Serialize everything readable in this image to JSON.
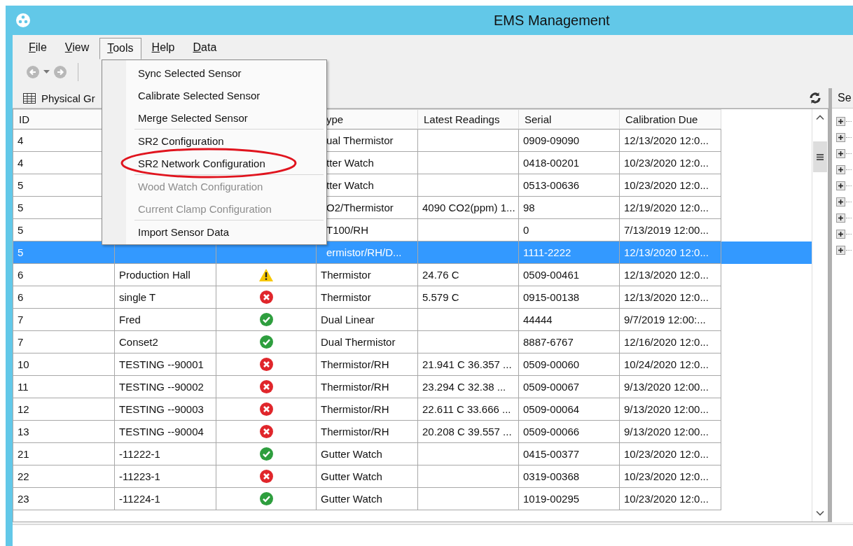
{
  "window": {
    "title": "EMS Management"
  },
  "menu_bar": [
    {
      "label": "File",
      "selected": false
    },
    {
      "label": "View",
      "selected": false
    },
    {
      "label": "Tools",
      "selected": true
    },
    {
      "label": "Help",
      "selected": false
    },
    {
      "label": "Data",
      "selected": false
    }
  ],
  "tools_menu": [
    {
      "kind": "item",
      "label": "Sync Selected Sensor",
      "disabled": false
    },
    {
      "kind": "item",
      "label": "Calibrate Selected Sensor",
      "disabled": false
    },
    {
      "kind": "item",
      "label": "Merge Selected Sensor",
      "disabled": false
    },
    {
      "kind": "separator"
    },
    {
      "kind": "item",
      "label": "SR2 Configuration",
      "disabled": false
    },
    {
      "kind": "item",
      "label": "SR2 Network Configuration",
      "disabled": false,
      "circled": true
    },
    {
      "kind": "separator"
    },
    {
      "kind": "item",
      "label": "Wood Watch Configuration",
      "disabled": true
    },
    {
      "kind": "item",
      "label": "Current Clamp Configuration",
      "disabled": true
    },
    {
      "kind": "separator"
    },
    {
      "kind": "item",
      "label": "Import Sensor Data",
      "disabled": false
    }
  ],
  "left_panel": {
    "title": "Physical Gr"
  },
  "table": {
    "columns": {
      "id": "ID",
      "type": "ype",
      "readings": "Latest Readings",
      "serial": "Serial",
      "due": "Calibration Due"
    },
    "rows": [
      {
        "id": "4",
        "type": "ual Thermistor",
        "serial": "0909-09090",
        "due": "12/13/2020 12:0...",
        "selected": false
      },
      {
        "id": "4",
        "type": "tter Watch",
        "serial": "0418-00201",
        "due": "10/23/2020 12:0...",
        "selected": false
      },
      {
        "id": "5",
        "type": "tter Watch",
        "serial": "0513-00636",
        "due": "10/23/2020 12:0...",
        "selected": false
      },
      {
        "id": "5",
        "type": "O2/Thermistor",
        "readings": "4090 CO2(ppm) 1...",
        "serial": "98",
        "due": "12/19/2020 12:0...",
        "selected": false
      },
      {
        "id": "5",
        "type": "T100/RH",
        "serial": "0",
        "due": "7/13/2019 12:00...",
        "selected": false
      },
      {
        "id": "5",
        "type": "ermistor/RH/D...",
        "serial": "1111-2222",
        "due": "12/13/2020 12:0...",
        "selected": true
      },
      {
        "id": "6",
        "name": "Production Hall",
        "kind": "warning",
        "type": "Thermistor",
        "readings": "24.76 C",
        "serial": "0509-00461",
        "due": "12/13/2020 12:0...",
        "selected": false
      },
      {
        "id": "6",
        "name": "single T",
        "kind": "error",
        "type": "Thermistor",
        "readings": "5.579 C",
        "serial": "0915-00138",
        "due": "12/13/2020 12:0...",
        "selected": false
      },
      {
        "id": "7",
        "name": "Fred",
        "kind": "ok",
        "type": "Dual Linear",
        "serial": "44444",
        "due": "9/7/2019 12:00:...",
        "selected": false
      },
      {
        "id": "7",
        "name": "Conset2",
        "kind": "ok",
        "type": "Dual Thermistor",
        "serial": "8887-6767",
        "due": "12/16/2020 12:0...",
        "selected": false
      },
      {
        "id": "10",
        "name": "TESTING --90001",
        "kind": "error",
        "type": "Thermistor/RH",
        "readings": "21.941 C 36.357 ...",
        "serial": "0509-00060",
        "due": "10/24/2020 12:0...",
        "selected": false
      },
      {
        "id": "11",
        "name": "TESTING --90002",
        "kind": "error",
        "type": "Thermistor/RH",
        "readings": "23.294 C 32.38 ...",
        "serial": "0509-00067",
        "due": "9/13/2020 12:00...",
        "selected": false
      },
      {
        "id": "12",
        "name": "TESTING --90003",
        "kind": "error",
        "type": "Thermistor/RH",
        "readings": "22.611 C 33.666 ...",
        "serial": "0509-00064",
        "due": "9/13/2020 12:00...",
        "selected": false
      },
      {
        "id": "13",
        "name": "TESTING --90004",
        "kind": "error",
        "type": "Thermistor/RH",
        "readings": "20.208 C 39.557 ...",
        "serial": "0509-00066",
        "due": "9/13/2020 12:00...",
        "selected": false
      },
      {
        "id": "21",
        "name": "-11222-1",
        "kind": "ok",
        "type": "Gutter Watch",
        "serial": "0415-00377",
        "due": "10/23/2020 12:0...",
        "selected": false
      },
      {
        "id": "22",
        "name": "-11223-1",
        "kind": "error",
        "type": "Gutter Watch",
        "serial": "0319-00368",
        "due": "10/23/2020 12:0...",
        "selected": false
      },
      {
        "id": "23",
        "name": "-11224-1",
        "kind": "ok",
        "type": "Gutter Watch",
        "serial": "1019-00295",
        "due": "10/23/2020 12:0...",
        "selected": false
      }
    ]
  },
  "right_panel": {
    "title": "Se",
    "tree": [
      {
        "expanded": false
      },
      {
        "expanded": false
      },
      {
        "expanded": false
      },
      {
        "expanded": false
      },
      {
        "expanded": false
      },
      {
        "expanded": false
      },
      {
        "expanded": false
      },
      {
        "expanded": false
      },
      {
        "expanded": false
      }
    ]
  }
}
